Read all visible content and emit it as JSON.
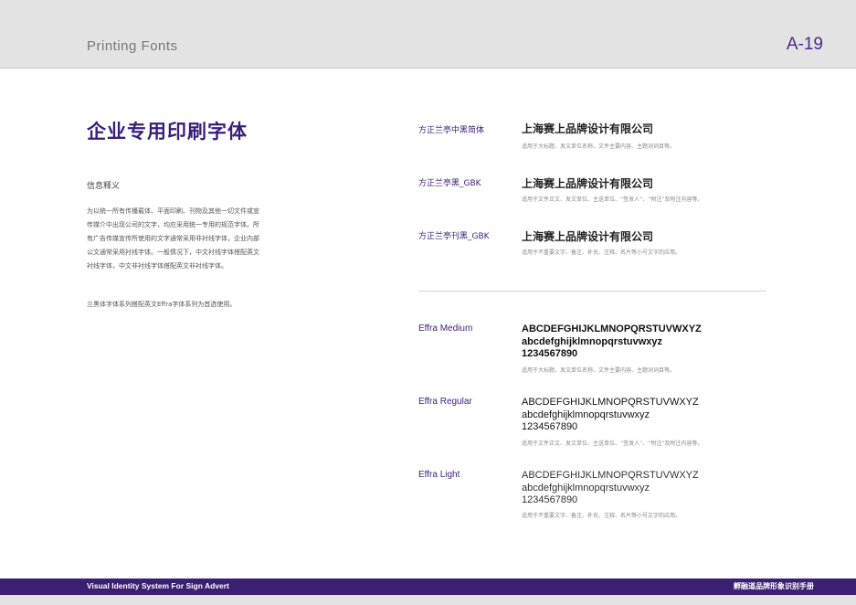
{
  "header": {
    "title": "Printing Fonts",
    "page_number": "A-19"
  },
  "main_title": "企业专用印刷字体",
  "info": {
    "heading": "信息释义",
    "body": "为以统一所有传播载体、平面印刷、刊物及其他一切文件或宣传媒介中出现公司的文字，均应采用统一专用的规范字体。所有广告传媒宣传所使用的文字通常采用非衬线字体，企业内部公文通常采用衬线字体。一般情况下，中文衬线字体搭配英文衬线字体，中文非衬线字体搭配英文非衬线字体。",
    "note": "兰黑体字体系列搭配英文Effra字体系列为首选使用。"
  },
  "chinese_fonts": [
    {
      "name": "方正兰亭中黑简体",
      "sample": "上海赛上品牌设计有限公司",
      "usage": "适用于大标题、发文单位名称、文件主要内容、主题词词目等。"
    },
    {
      "name": "方正兰亭黑_GBK",
      "sample": "上海赛上品牌设计有限公司",
      "usage": "适用于文件正文、发文单位、主送单位、“签发人”、“附注”及附注内容等。"
    },
    {
      "name": "方正兰亭刊黑_GBK",
      "sample": "上海赛上品牌设计有限公司",
      "usage": "适用于不重要文字、备注、补充、注释、名片等小号文字的应用。"
    }
  ],
  "latin_fonts": [
    {
      "name": "Effra Medium",
      "upper": "ABCDEFGHIJKLMNOPQRSTUVWXYZ",
      "lower": "abcdefghijklmnopqrstuvwxyz",
      "digits": "1234567890",
      "usage": "适用于大标题、发文单位名称、文件主要内容、主题词词目等。"
    },
    {
      "name": "Effra Regular",
      "upper": "ABCDEFGHIJKLMNOPQRSTUVWXYZ",
      "lower": "abcdefghijklmnopqrstuvwxyz",
      "digits": "1234567890",
      "usage": "适用于文件正文、发文单位、主送单位、“签发人”、“附注”及附注内容等。"
    },
    {
      "name": "Effra Light",
      "upper": "ABCDEFGHIJKLMNOPQRSTUVWXYZ",
      "lower": "abcdefghijklmnopqrstuvwxyz",
      "digits": "1234567890",
      "usage": "适用于不重要文字、备注、补充、注释、名片等小号文字的应用。"
    }
  ],
  "footer": {
    "left": "Visual Identity System For Sign Advert",
    "right": "孵融道品牌形象识别手册"
  },
  "colors": {
    "accent": "#3a1f7a",
    "footer_bg": "#3b1f73",
    "header_bg": "#e3e3e3",
    "divider": "#f0c6c6"
  }
}
